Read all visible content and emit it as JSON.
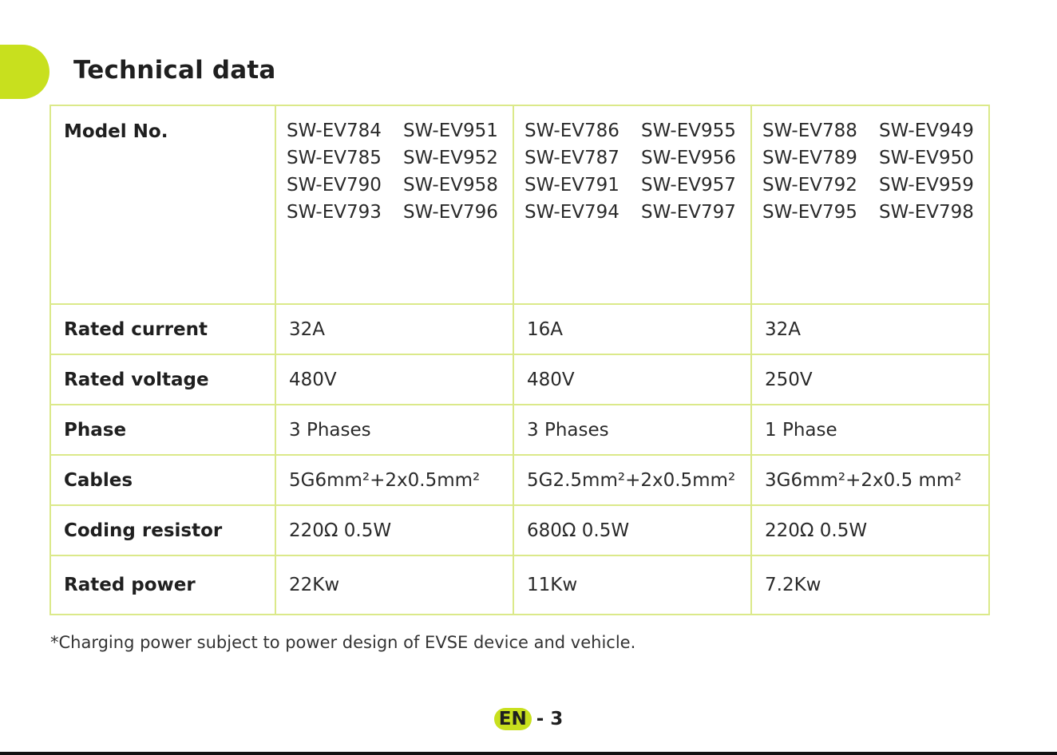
{
  "page": {
    "title": "Technical data",
    "footnote": "*Charging power subject to power design of EVSE device and vehicle.",
    "language_badge": "EN",
    "page_separator": "- 3",
    "accent_color": "#c8e01e",
    "border_color": "#dbe98a"
  },
  "table": {
    "model_label": "Model No.",
    "models": [
      [
        "SW-EV784",
        "SW-EV951",
        "SW-EV785",
        "SW-EV952",
        "SW-EV790",
        "SW-EV958",
        "SW-EV793",
        "SW-EV796"
      ],
      [
        "SW-EV786",
        "SW-EV955",
        "SW-EV787",
        "SW-EV956",
        "SW-EV791",
        "SW-EV957",
        "SW-EV794",
        "SW-EV797"
      ],
      [
        "SW-EV788",
        "SW-EV949",
        "SW-EV789",
        "SW-EV950",
        "SW-EV792",
        "SW-EV959",
        "SW-EV795",
        "SW-EV798"
      ]
    ],
    "rows": [
      {
        "label": "Rated current",
        "values": [
          "32A",
          "16A",
          "32A"
        ]
      },
      {
        "label": "Rated voltage",
        "values": [
          "480V",
          "480V",
          "250V"
        ]
      },
      {
        "label": "Phase",
        "values": [
          "3 Phases",
          "3 Phases",
          "1 Phase"
        ]
      },
      {
        "label": "Cables",
        "values": [
          "5G6mm²+2x0.5mm²",
          "5G2.5mm²+2x0.5mm²",
          "3G6mm²+2x0.5 mm²"
        ]
      },
      {
        "label": "Coding resistor",
        "values": [
          "220Ω 0.5W",
          "680Ω 0.5W",
          "220Ω 0.5W"
        ]
      },
      {
        "label": "Rated power",
        "values": [
          "22Kw",
          "11Kw",
          "7.2Kw"
        ]
      }
    ]
  }
}
